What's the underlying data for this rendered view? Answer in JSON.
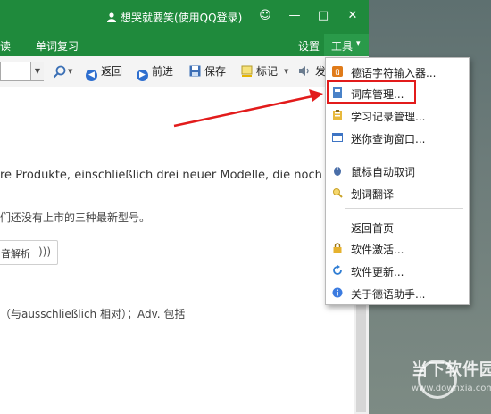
{
  "window": {
    "title": "想哭就要笑(使用QQ登录)",
    "controls": [
      "☺",
      "—",
      "□",
      "✕"
    ]
  },
  "menubar": {
    "items": [
      "读",
      "单词复习",
      "设置"
    ],
    "tools_label": "工具",
    "tools_arrow": "▾"
  },
  "toolbar": {
    "back": "返回",
    "forward": "前进",
    "save": "保存",
    "mark": "标记",
    "speak": "发"
  },
  "content": {
    "line1": "re Produkte, einschließlich drei neuer Modelle, die noch nicht",
    "line2": "们还没有上市的三种最新型号。",
    "audio_button": "音解析",
    "line3": "（与ausschließlich 相对）；Adv. 包括"
  },
  "dropdown": {
    "items": [
      {
        "label": "德语字符输入器...",
        "icon": "umlaut-icon"
      },
      {
        "label": "词库管理...",
        "icon": "book-icon"
      },
      {
        "label": "学习记录管理...",
        "icon": "clipboard-icon"
      },
      {
        "label": "迷你查询窗口...",
        "icon": "window-icon"
      },
      {
        "label": "鼠标自动取词",
        "icon": "mouse-icon"
      },
      {
        "label": "划词翻译",
        "icon": "magnifier-icon"
      },
      {
        "label": "返回首页",
        "icon": ""
      },
      {
        "label": "软件激活...",
        "icon": "lock-icon"
      },
      {
        "label": "软件更新...",
        "icon": "refresh-icon"
      },
      {
        "label": "关于德语助手...",
        "icon": "info-icon"
      }
    ]
  },
  "watermark": {
    "name": "当下软件园",
    "url": "www.downxia.com"
  },
  "colors": {
    "titlebar": "#1f8a3c",
    "highlight": "#e21b1b",
    "arrow": "#e21b1b"
  }
}
